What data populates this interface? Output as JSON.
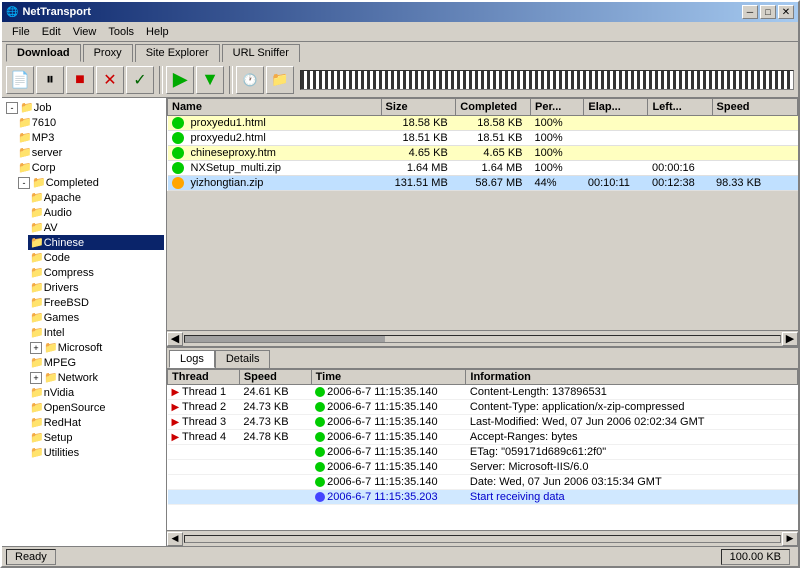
{
  "window": {
    "title": "NetTransport",
    "controls": {
      "minimize": "─",
      "maximize": "□",
      "close": "✕"
    }
  },
  "menubar": {
    "items": [
      "File",
      "Edit",
      "View",
      "Tools",
      "Help"
    ]
  },
  "tabs": {
    "items": [
      "Download",
      "Proxy",
      "Site Explorer",
      "URL Sniffer"
    ],
    "active": "Download"
  },
  "toolbar": {
    "buttons": [
      "▶",
      "⏸",
      "■",
      "✕",
      "✓"
    ],
    "green_down": "▼",
    "green_up": "▲"
  },
  "sidebar": {
    "items": [
      {
        "label": "Job",
        "level": 0,
        "type": "root",
        "expanded": true
      },
      {
        "label": "7610",
        "level": 1,
        "type": "folder"
      },
      {
        "label": "MP3",
        "level": 1,
        "type": "folder"
      },
      {
        "label": "server",
        "level": 1,
        "type": "folder"
      },
      {
        "label": "Corp",
        "level": 1,
        "type": "folder"
      },
      {
        "label": "Completed",
        "level": 1,
        "type": "folder",
        "expanded": true,
        "selected": false
      },
      {
        "label": "Apache",
        "level": 2,
        "type": "folder"
      },
      {
        "label": "Audio",
        "level": 2,
        "type": "folder"
      },
      {
        "label": "AV",
        "level": 2,
        "type": "folder"
      },
      {
        "label": "Chinese",
        "level": 2,
        "type": "folder",
        "selected": true
      },
      {
        "label": "Code",
        "level": 2,
        "type": "folder"
      },
      {
        "label": "Compress",
        "level": 2,
        "type": "folder"
      },
      {
        "label": "Drivers",
        "level": 2,
        "type": "folder"
      },
      {
        "label": "FreeBSD",
        "level": 2,
        "type": "folder"
      },
      {
        "label": "Games",
        "level": 2,
        "type": "folder"
      },
      {
        "label": "Intel",
        "level": 2,
        "type": "folder"
      },
      {
        "label": "Microsoft",
        "level": 2,
        "type": "folder",
        "has_children": true
      },
      {
        "label": "MPEG",
        "level": 2,
        "type": "folder"
      },
      {
        "label": "Network",
        "level": 2,
        "type": "folder",
        "has_children": true
      },
      {
        "label": "nVidia",
        "level": 2,
        "type": "folder"
      },
      {
        "label": "OpenSource",
        "level": 2,
        "type": "folder"
      },
      {
        "label": "RedHat",
        "level": 2,
        "type": "folder"
      },
      {
        "label": "Setup",
        "level": 2,
        "type": "folder"
      },
      {
        "label": "Utilities",
        "level": 2,
        "type": "folder"
      }
    ]
  },
  "file_list": {
    "columns": [
      "Name",
      "Size",
      "Completed",
      "Per...",
      "Elap...",
      "Left...",
      "Speed"
    ],
    "rows": [
      {
        "name": "proxyedu1.html",
        "size": "18.58 KB",
        "completed": "18.58 KB",
        "percent": "100%",
        "elapsed": "",
        "left": "",
        "speed": "",
        "status": "green"
      },
      {
        "name": "proxyedu2.html",
        "size": "18.51 KB",
        "completed": "18.51 KB",
        "percent": "100%",
        "elapsed": "",
        "left": "",
        "speed": "",
        "status": "green"
      },
      {
        "name": "chineseproxy.htm",
        "size": "4.65 KB",
        "completed": "4.65 KB",
        "percent": "100%",
        "elapsed": "",
        "left": "",
        "speed": "",
        "status": "green"
      },
      {
        "name": "NXSetup_multi.zip",
        "size": "1.64 MB",
        "completed": "1.64 MB",
        "percent": "100%",
        "elapsed": "",
        "left": "00:00:16",
        "speed": "",
        "status": "green"
      },
      {
        "name": "yizhongtian.zip",
        "size": "131.51 MB",
        "completed": "58.67 MB",
        "percent": "44%",
        "elapsed": "00:10:11",
        "left": "00:12:38",
        "speed": "98.33 KB",
        "status": "yellow"
      }
    ]
  },
  "log_panel": {
    "tabs": [
      "Logs",
      "Details"
    ],
    "active_tab": "Logs",
    "columns": [
      "Thread",
      "Speed",
      "Time",
      "Information"
    ],
    "rows": [
      {
        "thread": "Thread 1",
        "speed": "24.61 KB",
        "time": "2006-6-7 11:15:35.140",
        "info": "Content-Length: 137896531",
        "status": "green"
      },
      {
        "thread": "Thread 2",
        "speed": "24.73 KB",
        "time": "2006-6-7 11:15:35.140",
        "info": "Content-Type: application/x-zip-compressed",
        "status": "green"
      },
      {
        "thread": "Thread 3",
        "speed": "24.73 KB",
        "time": "2006-6-7 11:15:35.140",
        "info": "Last-Modified: Wed, 07 Jun 2006 02:02:34 GMT",
        "status": "green"
      },
      {
        "thread": "Thread 4",
        "speed": "24.78 KB",
        "time": "2006-6-7 11:15:35.140",
        "info": "Accept-Ranges: bytes",
        "status": "green"
      },
      {
        "thread": "",
        "speed": "",
        "time": "2006-6-7 11:15:35.140",
        "info": "ETag: \"059171d689c61:2f0\"",
        "status": "green"
      },
      {
        "thread": "",
        "speed": "",
        "time": "2006-6-7 11:15:35.140",
        "info": "Server: Microsoft-IIS/6.0",
        "status": "green"
      },
      {
        "thread": "",
        "speed": "",
        "time": "2006-6-7 11:15:35.140",
        "info": "Date: Wed, 07 Jun 2006 03:15:34 GMT",
        "status": "green"
      },
      {
        "thread": "",
        "speed": "",
        "time": "2006-6-7 11:15:35.203",
        "info": "Start receiving data",
        "status": "blue",
        "highlight": true
      }
    ]
  },
  "status_bar": {
    "left": "Ready",
    "right": "100.00 KB"
  }
}
